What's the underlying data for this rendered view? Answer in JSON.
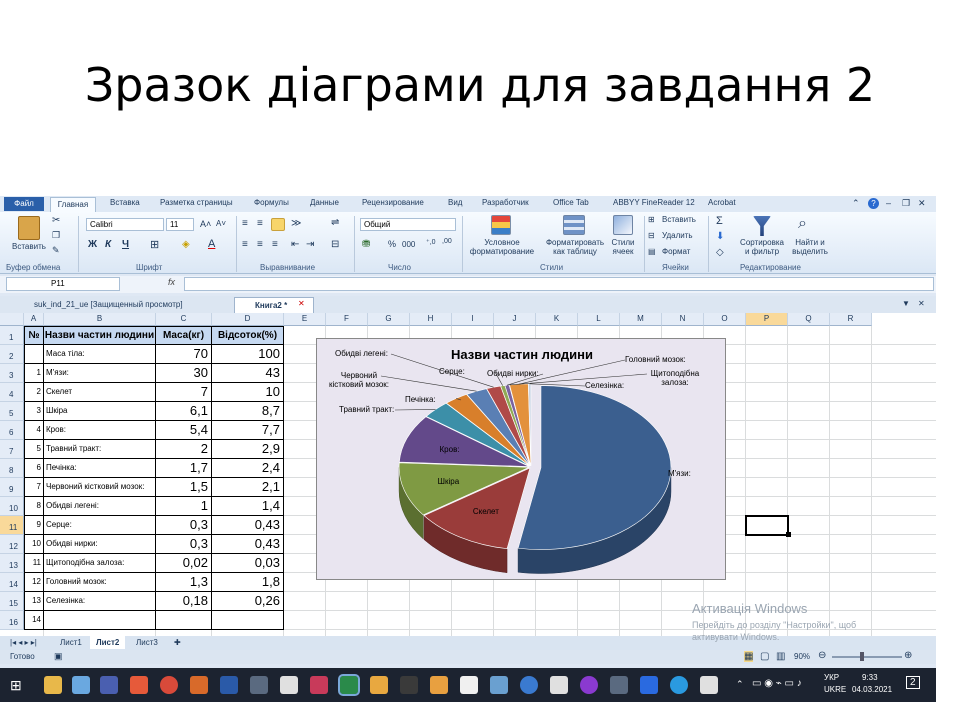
{
  "slide": {
    "title": "Зразок діаграми для завдання 2"
  },
  "ribbon": {
    "tabs": [
      "Файл",
      "Главная",
      "Вставка",
      "Разметка страницы",
      "Формулы",
      "Данные",
      "Рецензирование",
      "Вид",
      "Разработчик",
      "Office Tab",
      "ABBYY FineReader 12",
      "Acrobat"
    ],
    "paste_label": "Вставить",
    "font_name": "Calibri",
    "font_size": "11",
    "number_format": "Общий",
    "bold": "Ж",
    "italic": "К",
    "underline": "Ч",
    "percent": "%",
    "thousands": "000",
    "styles_cond": "Условное форматирование",
    "styles_table": "Форматировать как таблицу",
    "styles_cells": "Стили ячеек",
    "cells_insert": "Вставить",
    "cells_delete": "Удалить",
    "cells_format": "Формат",
    "sort_filter": "Сортировка и фильтр",
    "find_select": "Найти и выделить",
    "groups": [
      "Буфер обмена",
      "Шрифт",
      "Выравнивание",
      "Число",
      "Стили",
      "Ячейки",
      "Редактирование"
    ]
  },
  "formula_bar": {
    "name_box": "P11",
    "fx": "fx"
  },
  "doc_tabs": [
    "suk_ind_21_ue  [Защищенный просмотр]",
    "Книга2 *"
  ],
  "columns": [
    "A",
    "B",
    "C",
    "D",
    "E",
    "F",
    "G",
    "H",
    "I",
    "J",
    "K",
    "L",
    "M",
    "N",
    "O",
    "P",
    "Q",
    "R"
  ],
  "rows": [
    "1",
    "2",
    "3",
    "4",
    "5",
    "6",
    "7",
    "8",
    "9",
    "10",
    "11",
    "12",
    "13",
    "14",
    "15",
    "16"
  ],
  "table": {
    "header": {
      "no": "№",
      "name": "Назви частин людини",
      "mass": "Маса(кг)",
      "pct": "Відсоток(%)"
    },
    "body_mass": {
      "name": "Маса тіла:",
      "mass": "70",
      "pct": "100"
    },
    "items": [
      {
        "no": "1",
        "name": "М'язи:",
        "mass": "30",
        "pct": "43"
      },
      {
        "no": "2",
        "name": "Скелет",
        "mass": "7",
        "pct": "10"
      },
      {
        "no": "3",
        "name": "Шкіра",
        "mass": "6,1",
        "pct": "8,7"
      },
      {
        "no": "4",
        "name": "Кров:",
        "mass": "5,4",
        "pct": "7,7"
      },
      {
        "no": "5",
        "name": "Травний тракт:",
        "mass": "2",
        "pct": "2,9"
      },
      {
        "no": "6",
        "name": "Печінка:",
        "mass": "1,7",
        "pct": "2,4"
      },
      {
        "no": "7",
        "name": "Червоний кістковий мозок:",
        "mass": "1,5",
        "pct": "2,1"
      },
      {
        "no": "8",
        "name": "Обидві легені:",
        "mass": "1",
        "pct": "1,4"
      },
      {
        "no": "9",
        "name": "Серце:",
        "mass": "0,3",
        "pct": "0,43"
      },
      {
        "no": "10",
        "name": "Обидві нирки:",
        "mass": "0,3",
        "pct": "0,43"
      },
      {
        "no": "11",
        "name": "Щитоподібна залоза:",
        "mass": "0,02",
        "pct": "0,03"
      },
      {
        "no": "12",
        "name": "Головний мозок:",
        "mass": "1,3",
        "pct": "1,8"
      },
      {
        "no": "13",
        "name": "Селезінка:",
        "mass": "0,18",
        "pct": "0,26"
      },
      {
        "no": "14",
        "name": "",
        "mass": "",
        "pct": ""
      }
    ]
  },
  "chart_data": {
    "type": "pie",
    "title": "Назви частин людини",
    "categories": [
      "М'язи:",
      "Скелет",
      "Шкіра",
      "Кров:",
      "Травний тракт:",
      "Печінка:",
      "Червоний кістковий мозок:",
      "Обидві легені:",
      "Серце:",
      "Обидві нирки:",
      "Щитоподібна залоза:",
      "Головний мозок:",
      "Селезінка:"
    ],
    "values": [
      30,
      7,
      6.1,
      5.4,
      2,
      1.7,
      1.5,
      1,
      0.3,
      0.3,
      0.02,
      1.3,
      0.18
    ],
    "colors": [
      "#3b5f8f",
      "#9a3c3a",
      "#7f9a43",
      "#63498a",
      "#3c8fa8",
      "#d87f2b",
      "#5a7fb4",
      "#b04a48",
      "#90aa55",
      "#7a63a1",
      "#4a9fb6",
      "#e3913c",
      "#c9d3e4"
    ],
    "legend": "none",
    "style": "3d-exploded"
  },
  "sheet_tabs": [
    "Лист1",
    "Лист2",
    "Лист3"
  ],
  "status": {
    "ready": "Готово",
    "zoom": "90%"
  },
  "watermark": {
    "line1": "Активація Windows",
    "line2": "Перейдіть до розділу \"Настройки\", щоб",
    "line3": "активувати Windows."
  },
  "taskbar": {
    "lang1": "УКР",
    "lang2": "UKRE",
    "time": "9:33",
    "date": "04.03.2021",
    "notify": "2"
  }
}
